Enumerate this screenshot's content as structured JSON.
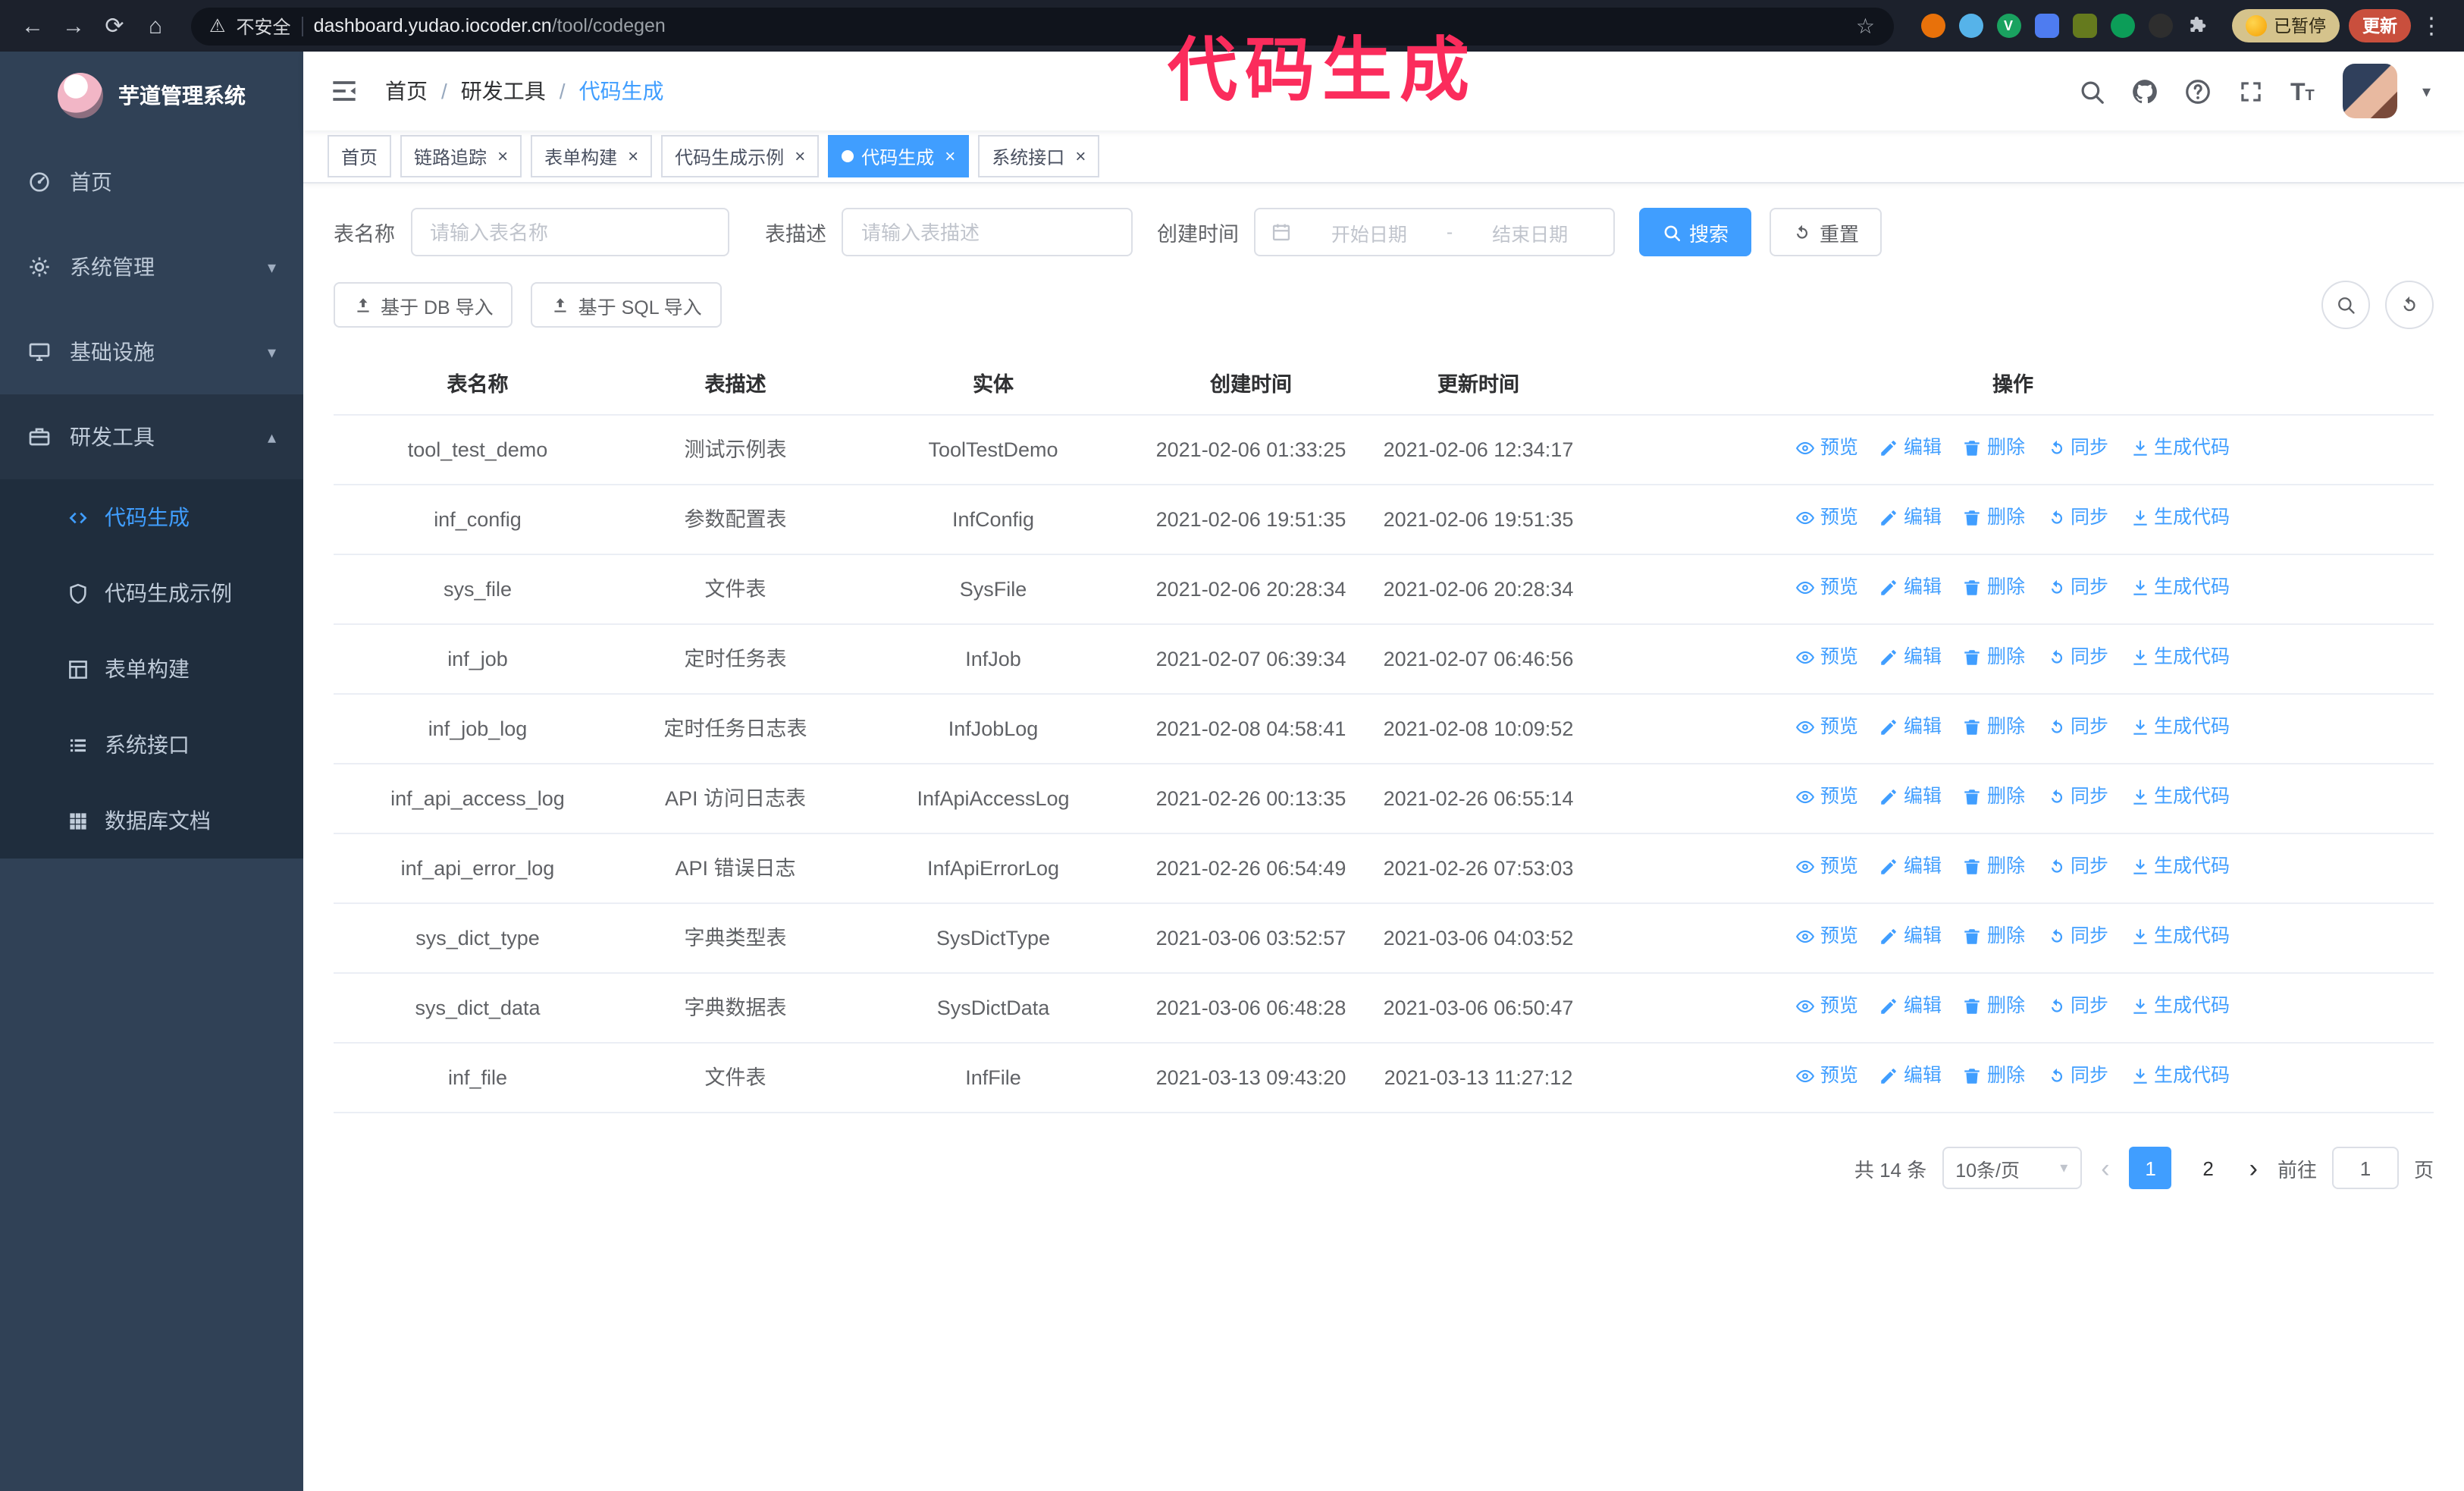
{
  "annotation": "代码生成",
  "colors": {
    "accent": "#409eff",
    "sidebar_bg": "#304156",
    "submenu_bg": "#1f2d3d",
    "annotation": "#fb2c5c"
  },
  "browser": {
    "security_label": "不安全",
    "url_domain": "dashboard.yudao.iocoder.cn",
    "url_path": "/tool/codegen",
    "paused_badge": "已暂停",
    "update_button": "更新"
  },
  "ui": {
    "back_glyph": "←",
    "forward_glyph": "→",
    "reload_glyph": "⟳",
    "home_glyph": "⌂",
    "warning_glyph": "⚠",
    "star_glyph": "☆",
    "more_glyph": "⋮",
    "close_glyph": "×",
    "chevron_down": "▾",
    "chevron_up": "▴",
    "caret_down": "▾",
    "prev_glyph": "‹",
    "next_glyph": "›",
    "t_big": "T",
    "t_small": "T",
    "v_glyph": "V"
  },
  "sidebar": {
    "logo_title": "芋道管理系统",
    "items": [
      {
        "label": "首页"
      },
      {
        "label": "系统管理"
      },
      {
        "label": "基础设施"
      },
      {
        "label": "研发工具"
      }
    ],
    "sub_items": [
      {
        "label": "代码生成"
      },
      {
        "label": "代码生成示例"
      },
      {
        "label": "表单构建"
      },
      {
        "label": "系统接口"
      },
      {
        "label": "数据库文档"
      }
    ]
  },
  "breadcrumb": {
    "items": [
      "首页",
      "研发工具",
      "代码生成"
    ],
    "separator": "/"
  },
  "tabs": [
    {
      "label": "首页"
    },
    {
      "label": "链路追踪"
    },
    {
      "label": "表单构建"
    },
    {
      "label": "代码生成示例"
    },
    {
      "label": "代码生成"
    },
    {
      "label": "系统接口"
    }
  ],
  "filters": {
    "table_name_label": "表名称",
    "table_name_placeholder": "请输入表名称",
    "table_desc_label": "表描述",
    "table_desc_placeholder": "请输入表描述",
    "create_time_label": "创建时间",
    "date_start_placeholder": "开始日期",
    "date_separator": "-",
    "date_end_placeholder": "结束日期",
    "search_button": "搜索",
    "reset_button": "重置"
  },
  "toolbar": {
    "import_db_button": "基于 DB 导入",
    "import_sql_button": "基于 SQL 导入"
  },
  "table": {
    "columns": [
      "表名称",
      "表描述",
      "实体",
      "创建时间",
      "更新时间",
      "操作"
    ],
    "actions": [
      "预览",
      "编辑",
      "删除",
      "同步",
      "生成代码"
    ],
    "rows": [
      {
        "name": "tool_test_demo",
        "desc": "测试示例表",
        "entity": "ToolTestDemo",
        "created": "2021-02-06 01:33:25",
        "updated": "2021-02-06 12:34:17"
      },
      {
        "name": "inf_config",
        "desc": "参数配置表",
        "entity": "InfConfig",
        "created": "2021-02-06 19:51:35",
        "updated": "2021-02-06 19:51:35"
      },
      {
        "name": "sys_file",
        "desc": "文件表",
        "entity": "SysFile",
        "created": "2021-02-06 20:28:34",
        "updated": "2021-02-06 20:28:34"
      },
      {
        "name": "inf_job",
        "desc": "定时任务表",
        "entity": "InfJob",
        "created": "2021-02-07 06:39:34",
        "updated": "2021-02-07 06:46:56"
      },
      {
        "name": "inf_job_log",
        "desc": "定时任务日志表",
        "entity": "InfJobLog",
        "created": "2021-02-08 04:58:41",
        "updated": "2021-02-08 10:09:52"
      },
      {
        "name": "inf_api_access_log",
        "desc": "API 访问日志表",
        "entity": "InfApiAccessLog",
        "created": "2021-02-26 00:13:35",
        "updated": "2021-02-26 06:55:14"
      },
      {
        "name": "inf_api_error_log",
        "desc": "API 错误日志",
        "entity": "InfApiErrorLog",
        "created": "2021-02-26 06:54:49",
        "updated": "2021-02-26 07:53:03"
      },
      {
        "name": "sys_dict_type",
        "desc": "字典类型表",
        "entity": "SysDictType",
        "created": "2021-03-06 03:52:57",
        "updated": "2021-03-06 04:03:52"
      },
      {
        "name": "sys_dict_data",
        "desc": "字典数据表",
        "entity": "SysDictData",
        "created": "2021-03-06 06:48:28",
        "updated": "2021-03-06 06:50:47"
      },
      {
        "name": "inf_file",
        "desc": "文件表",
        "entity": "InfFile",
        "created": "2021-03-13 09:43:20",
        "updated": "2021-03-13 11:27:12"
      }
    ]
  },
  "pagination": {
    "total_label": "共 14 条",
    "page_size_label": "10条/页",
    "pages": [
      "1",
      "2"
    ],
    "goto_label": "前往",
    "goto_value": "1",
    "goto_unit": "页"
  }
}
